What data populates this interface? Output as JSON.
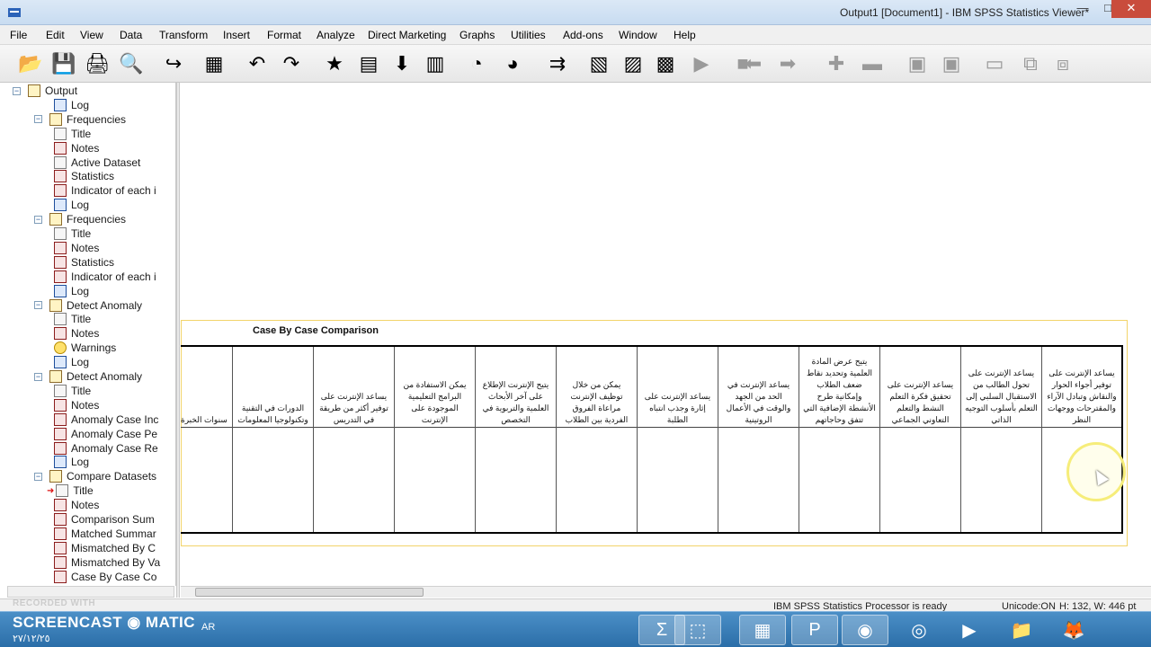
{
  "window": {
    "title": "Output1 [Document1] - IBM SPSS Statistics Viewer*",
    "minimize_glyph": "—",
    "maximize_glyph": "□",
    "close_glyph": "✕"
  },
  "menu": [
    "File",
    "Edit",
    "View",
    "Data",
    "Transform",
    "Insert",
    "Format",
    "Analyze",
    "Direct Marketing",
    "Graphs",
    "Utilities",
    "Add-ons",
    "Window",
    "Help"
  ],
  "toolbar": {
    "icons": [
      "open-icon",
      "save-icon",
      "print-icon",
      "print-preview-icon",
      "export-icon",
      "recall-dialog-icon",
      "undo-icon",
      "redo-icon",
      "goto-data-icon",
      "goto-case-icon",
      "goto-variable-icon",
      "variables-icon",
      "use-variable-sets-icon",
      "show-all-variables-icon",
      "spelling-icon",
      "designate-window-icon",
      "insert-heading-icon",
      "insert-title-icon",
      "insert-text-icon",
      "create-table-icon",
      "previous-icon",
      "next-icon",
      "promote-icon",
      "demote-icon",
      "expand-icon",
      "collapse-icon",
      "show-icon",
      "hide-icon",
      "insert-page-icon"
    ],
    "glyphs": [
      "📂",
      "💾",
      "🖨",
      "🔍",
      "↪",
      "▦",
      "↶",
      "↷",
      "★",
      "▤",
      "⬇",
      "▥",
      "◔",
      "◕",
      "⇉",
      "▧",
      "▨",
      "▩",
      "▶",
      "■",
      "⬅",
      "➡",
      "✚",
      "▬",
      "▣",
      "▣",
      "▭",
      "⧉",
      "⧈"
    ]
  },
  "outline": [
    {
      "level": 0,
      "label": "Output",
      "icon": "output-book-icon",
      "expander": "−"
    },
    {
      "level": 2,
      "label": "Log",
      "icon": "log-icon"
    },
    {
      "level": 1,
      "label": "Frequencies",
      "icon": "frequencies-book-icon",
      "expander": "−"
    },
    {
      "level": 2,
      "label": "Title",
      "icon": "title-icon"
    },
    {
      "level": 2,
      "label": "Notes",
      "icon": "notes-icon"
    },
    {
      "level": 2,
      "label": "Active Dataset",
      "icon": "active-dataset-icon"
    },
    {
      "level": 2,
      "label": "Statistics",
      "icon": "statistics-table-icon"
    },
    {
      "level": 2,
      "label": "Indicator of each i",
      "icon": "table-icon"
    },
    {
      "level": 2,
      "label": "Log",
      "icon": "log-icon"
    },
    {
      "level": 1,
      "label": "Frequencies",
      "icon": "frequencies-book-icon",
      "expander": "−"
    },
    {
      "level": 2,
      "label": "Title",
      "icon": "title-icon"
    },
    {
      "level": 2,
      "label": "Notes",
      "icon": "notes-icon"
    },
    {
      "level": 2,
      "label": "Statistics",
      "icon": "statistics-table-icon"
    },
    {
      "level": 2,
      "label": "Indicator of each i",
      "icon": "table-icon"
    },
    {
      "level": 2,
      "label": "Log",
      "icon": "log-icon"
    },
    {
      "level": 1,
      "label": "Detect Anomaly",
      "icon": "detect-anomaly-book-icon",
      "expander": "−"
    },
    {
      "level": 2,
      "label": "Title",
      "icon": "title-icon"
    },
    {
      "level": 2,
      "label": "Notes",
      "icon": "notes-icon"
    },
    {
      "level": 2,
      "label": "Warnings",
      "icon": "warning-icon"
    },
    {
      "level": 2,
      "label": "Log",
      "icon": "log-icon"
    },
    {
      "level": 1,
      "label": "Detect Anomaly",
      "icon": "detect-anomaly-book-icon",
      "expander": "−"
    },
    {
      "level": 2,
      "label": "Title",
      "icon": "title-icon"
    },
    {
      "level": 2,
      "label": "Notes",
      "icon": "notes-icon"
    },
    {
      "level": 2,
      "label": "Anomaly Case Inc",
      "icon": "table-icon"
    },
    {
      "level": 2,
      "label": "Anomaly Case Pe",
      "icon": "table-icon"
    },
    {
      "level": 2,
      "label": "Anomaly Case Re",
      "icon": "table-icon"
    },
    {
      "level": 2,
      "label": "Log",
      "icon": "log-icon"
    },
    {
      "level": 1,
      "label": "Compare Datasets",
      "icon": "compare-datasets-book-icon",
      "expander": "−"
    },
    {
      "level": 2,
      "label": "Title",
      "icon": "title-icon",
      "current": true
    },
    {
      "level": 2,
      "label": "Notes",
      "icon": "notes-icon"
    },
    {
      "level": 2,
      "label": "Comparison Sum",
      "icon": "table-icon"
    },
    {
      "level": 2,
      "label": "Matched Summar",
      "icon": "table-icon"
    },
    {
      "level": 2,
      "label": "Mismatched By C",
      "icon": "table-icon"
    },
    {
      "level": 2,
      "label": "Mismatched By Va",
      "icon": "table-icon"
    },
    {
      "level": 2,
      "label": "Case By Case Co",
      "icon": "table-icon"
    }
  ],
  "pivot": {
    "title": "Case By Case Comparison",
    "columns": [
      "سنوات الخبرة",
      "الدورات في التقنية وتكنولوجيا المعلومات",
      "يساعد الإنترنت على توفير أكثر من طريقة في التدريس",
      "يمكن الاستفادة من البرامج التعليمية الموجودة على الإنترنت",
      "يتيح الإنترنت الإطلاع على آخر الأبحاث العلمية والتربوية في التخصص",
      "يمكن من خلال توظيف الإنترنت مراعاة الفروق الفردية بين الطلاب",
      "يساعد الإنترنت على إثارة وجذب انتباه الطلبة",
      "يساعد الإنترنت في الحد من الجهد والوقت في الأعمال الروتينية",
      "يتيح عرض المادة العلمية وتحديد نقاط ضعف الطلاب وإمكانية طرح الأنشطة الإضافية التي تتفق وحاجاتهم",
      "يساعد الإنترنت على تحقيق فكرة التعلم النشط والتعلم التعاوني الجماعي",
      "يساعد الإنترنت على تحول الطالب من الاستقبال السلبي إلى التعلم بأسلوب التوجيه الذاتي",
      "يساعد الإنترنت على توفير أجواء الحوار والنقاش وتبادل الآراء والمقترحات ووجهات النظر"
    ]
  },
  "status": {
    "processor": "IBM SPSS Statistics Processor is ready",
    "unicode": "Unicode:ON",
    "dimensions": "H: 132, W: 446 pt"
  },
  "recorder": {
    "recorded_with": "RECORDED WITH",
    "brand": "SCREENCAST ◉ MATIC",
    "lang": "AR",
    "date": "٢٧/١٢/٢٥"
  },
  "taskbar": {
    "apps": [
      "spss-icon",
      "snipping-tool-icon",
      "spss-data-editor-icon",
      "spss-viewer-icon",
      "browser-icon",
      "chrome-icon",
      "media-player-icon",
      "file-explorer-icon",
      "firefox-icon"
    ],
    "glyphs": [
      "Σ",
      "⬚",
      "▦",
      "P",
      "◉",
      "◎",
      "▶",
      "📁",
      "🦊"
    ]
  }
}
